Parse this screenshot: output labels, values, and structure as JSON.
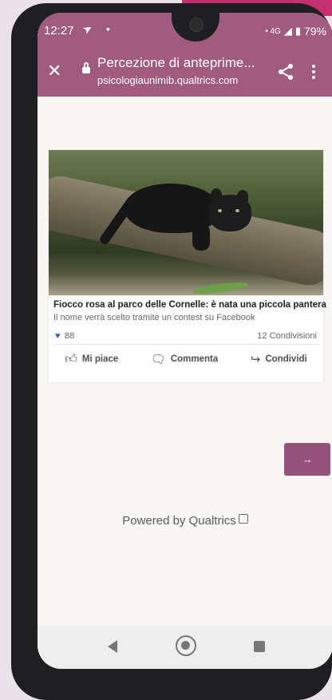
{
  "status_bar": {
    "time": "12:27",
    "send_icon": "telegram-send-icon",
    "dot": "•",
    "network": "• 4G",
    "battery": "79%"
  },
  "app_bar": {
    "title": "Percezione di anteprime...",
    "url": "psicologiaunimib.qualtrics.com",
    "close_icon": "close-icon",
    "lock_icon": "lock-icon",
    "share_icon": "share-icon",
    "more_icon": "more-vert-icon",
    "bg_color": "#a15b7f"
  },
  "post": {
    "title": "Fiocco rosa al parco delle Cornelle: è nata una piccola pantera",
    "subtitle": "Il nome verrà scelto tramite un contest su Facebook",
    "likes": "88",
    "shares": "12 Condivisioni",
    "actions": {
      "like": "Mi piace",
      "comment": "Commenta",
      "share": "Condividi"
    }
  },
  "next_button": {
    "label": "→",
    "color": "#94527a"
  },
  "footer": {
    "powered_by": "Powered by Qualtrics"
  }
}
